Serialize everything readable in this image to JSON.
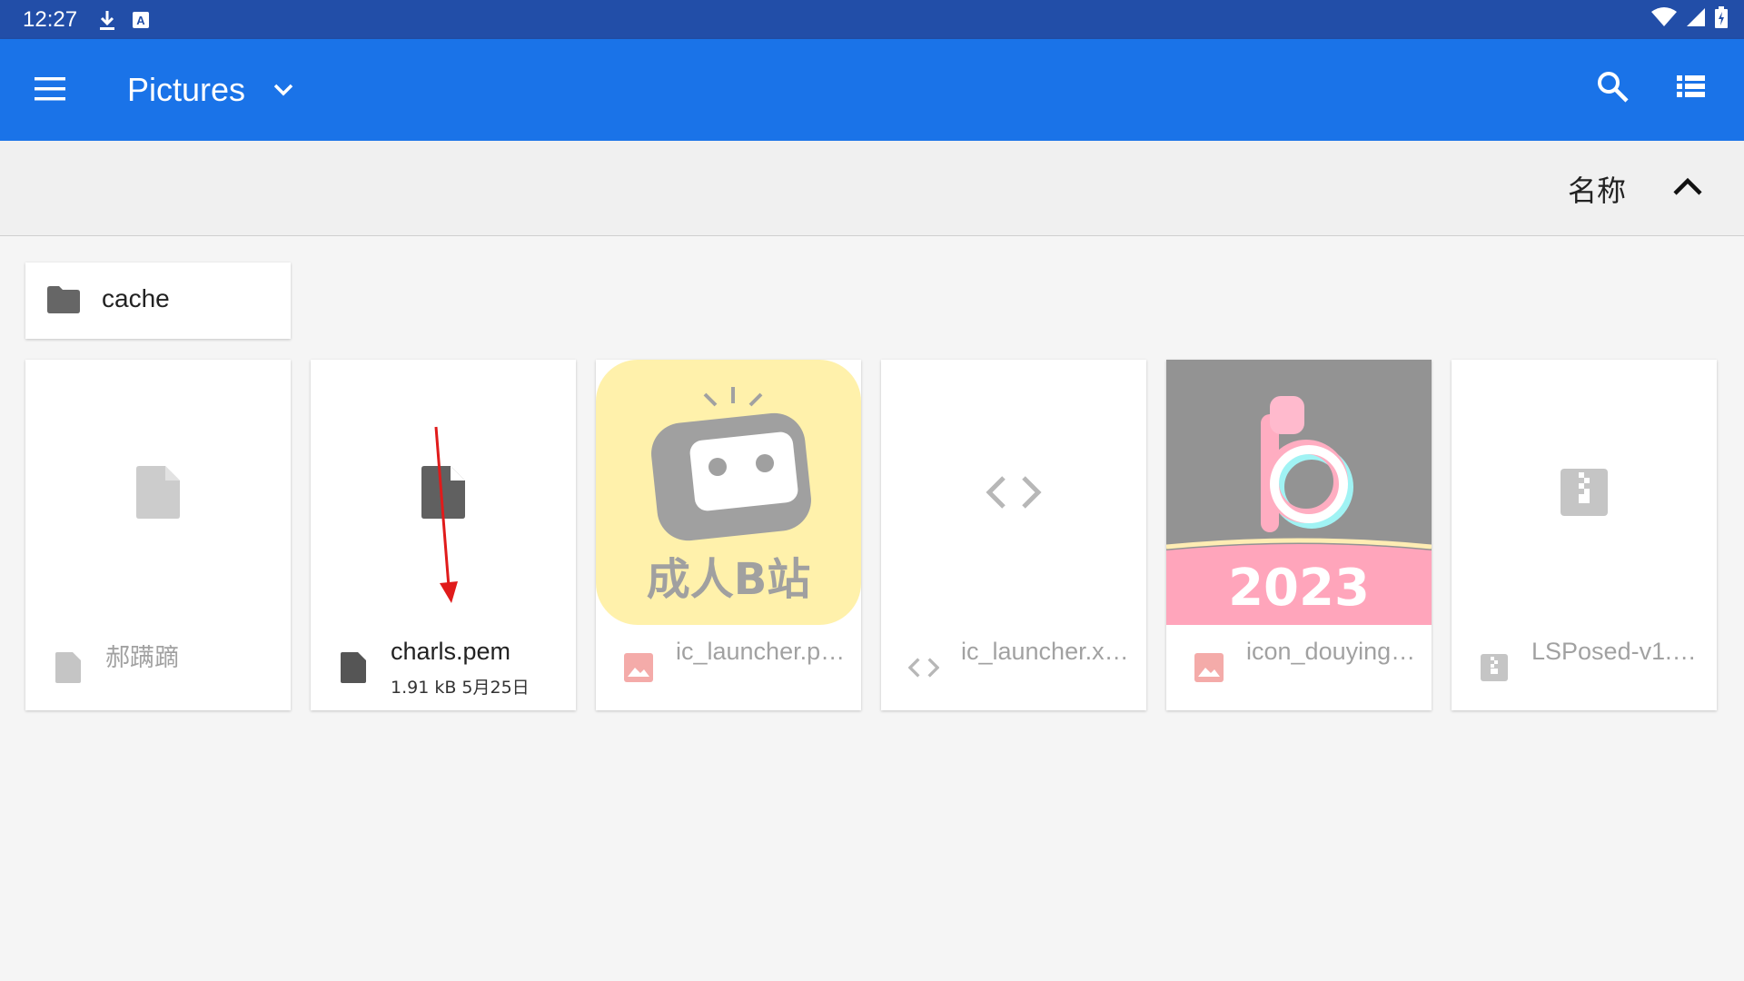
{
  "status_bar": {
    "time": "12:27",
    "left_icons": [
      "download-icon",
      "text-a-icon"
    ],
    "right_icons": [
      "wifi-icon",
      "signal-icon",
      "battery-icon"
    ]
  },
  "app_bar": {
    "title": "Pictures",
    "background_color": "#1a73e8",
    "icons": [
      "menu-icon",
      "chevron-down-icon",
      "search-icon",
      "list-view-icon"
    ]
  },
  "sort_bar": {
    "label": "名称",
    "direction_icon": "chevron-up-icon"
  },
  "folders": [
    {
      "name": "cache",
      "icon": "folder-icon"
    }
  ],
  "files": [
    {
      "name": "郝蹒蹢",
      "meta": "",
      "icon": "file-icon",
      "dimmed": true
    },
    {
      "name": "charls.pem",
      "meta": "1.91 kB 5月25日",
      "icon": "file-icon",
      "dimmed": false
    },
    {
      "name": "ic_launcher.p…",
      "meta": "",
      "icon": "image-icon",
      "dimmed": true,
      "thumbnail_text": "成人B站"
    },
    {
      "name": "ic_launcher.x…",
      "meta": "",
      "icon": "code-icon",
      "dimmed": true
    },
    {
      "name": "icon_douying…",
      "meta": "",
      "icon": "image-icon",
      "dimmed": true,
      "thumbnail_text": "2023"
    },
    {
      "name": "LSPosed-v1.…",
      "meta": "",
      "icon": "archive-icon",
      "dimmed": true
    }
  ],
  "annotation": {
    "type": "red-arrow",
    "color": "#e01b1b"
  }
}
